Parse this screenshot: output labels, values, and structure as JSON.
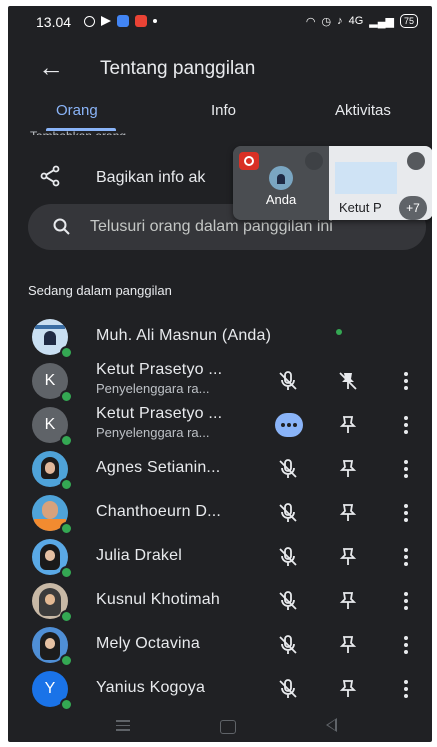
{
  "status_bar": {
    "time": "13.04",
    "battery": "75",
    "network": "4G"
  },
  "header": {
    "title": "Tentang panggilan"
  },
  "tabs": [
    {
      "label": "Orang",
      "active": true
    },
    {
      "label": "Info",
      "active": false
    },
    {
      "label": "Aktivitas",
      "active": false
    }
  ],
  "cutoff_text": "Tambahkan orang",
  "share": {
    "label": "Bagikan info ak"
  },
  "search": {
    "placeholder": "Telusuri orang dalam panggilan ini"
  },
  "pip": {
    "self_label": "Anda",
    "other_label": "Ketut P",
    "more_count": "+7"
  },
  "section_title": "Sedang dalam panggilan",
  "participants": [
    {
      "name": "Muh. Ali Masnun (Anda)",
      "avatar": "photo"
    },
    {
      "name": "Ketut Prasetyo ...",
      "role": "Penyelenggara ra...",
      "avatar_letter": "K"
    },
    {
      "name": "Ketut Prasetyo ...",
      "role": "Penyelenggara ra...",
      "avatar_letter": "K"
    },
    {
      "name": "Agnes Setianin...",
      "avatar": "photo"
    },
    {
      "name": "Chanthoeurn D...",
      "avatar": "photo"
    },
    {
      "name": "Julia Drakel",
      "avatar": "photo"
    },
    {
      "name": "Kusnul Khotimah",
      "avatar": "photo"
    },
    {
      "name": "Mely Octavina",
      "avatar": "photo"
    },
    {
      "name": "Yanius Kogoya",
      "avatar_letter": "Y"
    }
  ],
  "colors": {
    "background": "#202124",
    "accent": "#8ab4f8",
    "online": "#34a853",
    "record": "#d93025"
  }
}
